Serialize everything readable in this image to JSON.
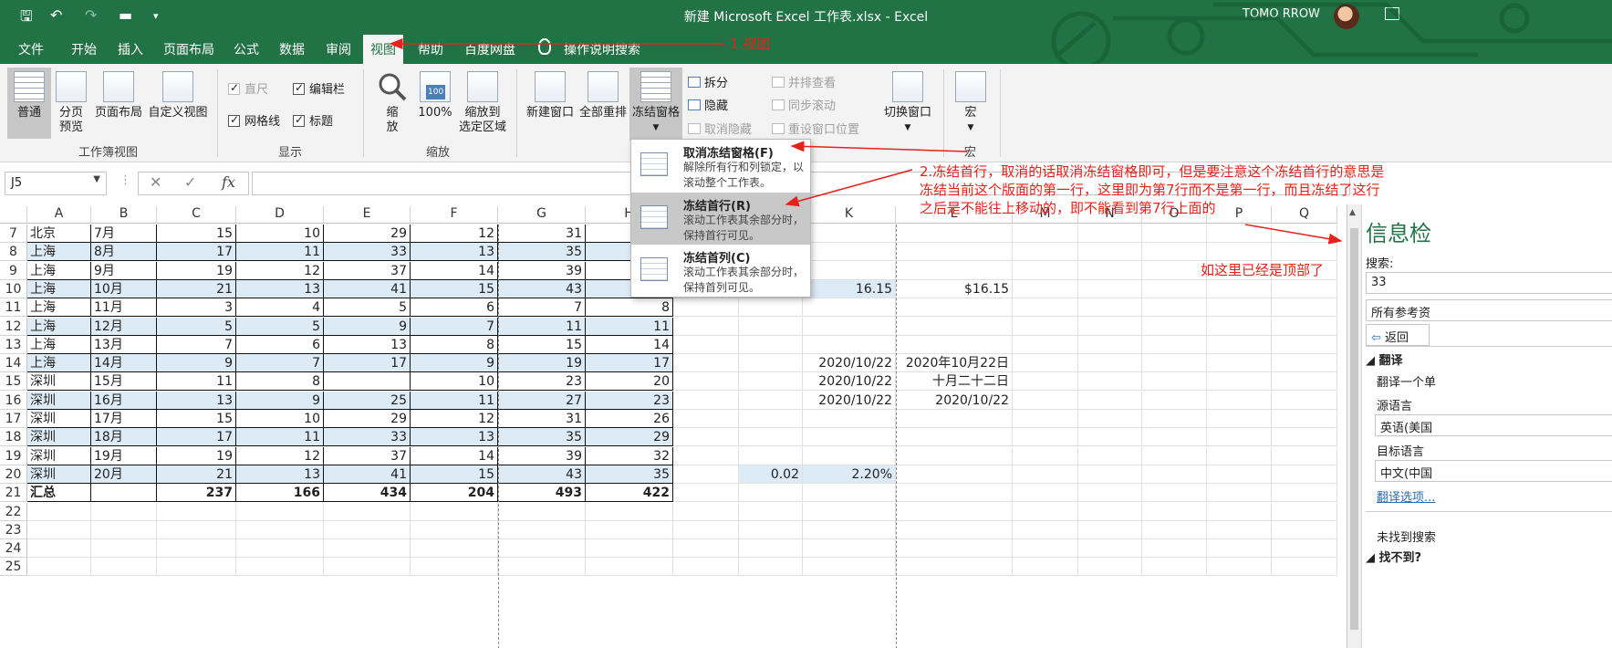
{
  "titlebar": {
    "title": "新建 Microsoft Excel 工作表.xlsx  -  Excel",
    "user": "TOMO RROW"
  },
  "tabs": [
    "文件",
    "开始",
    "插入",
    "页面布局",
    "公式",
    "数据",
    "审阅",
    "视图",
    "帮助",
    "百度网盘",
    "操作说明搜索"
  ],
  "active_tab": "视图",
  "ribbon": {
    "workbook_views": {
      "label": "工作簿视图",
      "normal": "普通",
      "page_break_line1": "分页",
      "page_break_line2": "预览",
      "page_layout": "页面布局",
      "custom": "自定义视图"
    },
    "show": {
      "label": "显示",
      "ruler": "直尺",
      "formula_bar": "编辑栏",
      "gridlines": "网格线",
      "headings": "标题"
    },
    "zoom": {
      "label": "缩放",
      "zoom_line1": "缩",
      "zoom_line2": "放",
      "zoom_100": "100%",
      "zoom_sel_line1": "缩放到",
      "zoom_sel_line2": "选定区域",
      "icon_100": "100"
    },
    "window": {
      "new_window": "新建窗口",
      "arrange_all": "全部重排",
      "freeze": "冻结窗格",
      "split": "拆分",
      "hide": "隐藏",
      "unhide": "取消隐藏",
      "side_by_side": "并排查看",
      "sync_scroll": "同步滚动",
      "reset_pos": "重设窗口位置",
      "switch_window": "切换窗口"
    },
    "macros": {
      "label": "宏",
      "macro": "宏"
    }
  },
  "formula_bar": {
    "name_box": "J5",
    "fx": "fx",
    "cancel": "✕",
    "enter": "✓"
  },
  "columns": [
    "A",
    "B",
    "C",
    "D",
    "E",
    "F",
    "G",
    "H",
    "K",
    "L",
    "M",
    "N",
    "O",
    "P",
    "Q"
  ],
  "rows": [
    {
      "n": "7",
      "a": "北京",
      "b": "7月",
      "c": "15",
      "d": "10",
      "e": "29",
      "f": "12",
      "g": "31",
      "h": ""
    },
    {
      "n": "8",
      "a": "上海",
      "b": "8月",
      "c": "17",
      "d": "11",
      "e": "33",
      "f": "13",
      "g": "35",
      "h": ""
    },
    {
      "n": "9",
      "a": "上海",
      "b": "9月",
      "c": "19",
      "d": "12",
      "e": "37",
      "f": "14",
      "g": "39",
      "h": ""
    },
    {
      "n": "10",
      "a": "上海",
      "b": "10月",
      "c": "21",
      "d": "13",
      "e": "41",
      "f": "15",
      "g": "43",
      "h": ""
    },
    {
      "n": "11",
      "a": "上海",
      "b": "11月",
      "c": "3",
      "d": "4",
      "e": "5",
      "f": "6",
      "g": "7",
      "h": "8"
    },
    {
      "n": "12",
      "a": "上海",
      "b": "12月",
      "c": "5",
      "d": "5",
      "e": "9",
      "f": "7",
      "g": "11",
      "h": "11"
    },
    {
      "n": "13",
      "a": "上海",
      "b": "13月",
      "c": "7",
      "d": "6",
      "e": "13",
      "f": "8",
      "g": "15",
      "h": "14"
    },
    {
      "n": "14",
      "a": "上海",
      "b": "14月",
      "c": "9",
      "d": "7",
      "e": "17",
      "f": "9",
      "g": "19",
      "h": "17"
    },
    {
      "n": "15",
      "a": "深圳",
      "b": "15月",
      "c": "11",
      "d": "8",
      "e": "",
      "f": "10",
      "g": "23",
      "h": "20"
    },
    {
      "n": "16",
      "a": "深圳",
      "b": "16月",
      "c": "13",
      "d": "9",
      "e": "25",
      "f": "11",
      "g": "27",
      "h": "23"
    },
    {
      "n": "17",
      "a": "深圳",
      "b": "17月",
      "c": "15",
      "d": "10",
      "e": "29",
      "f": "12",
      "g": "31",
      "h": "26"
    },
    {
      "n": "18",
      "a": "深圳",
      "b": "18月",
      "c": "17",
      "d": "11",
      "e": "33",
      "f": "13",
      "g": "35",
      "h": "29"
    },
    {
      "n": "19",
      "a": "深圳",
      "b": "19月",
      "c": "19",
      "d": "12",
      "e": "37",
      "f": "14",
      "g": "39",
      "h": "32"
    },
    {
      "n": "20",
      "a": "深圳",
      "b": "20月",
      "c": "21",
      "d": "13",
      "e": "41",
      "f": "15",
      "g": "43",
      "h": "35"
    },
    {
      "n": "21",
      "a": "汇总",
      "b": "",
      "c": "237",
      "d": "166",
      "e": "434",
      "f": "204",
      "g": "493",
      "h": "422"
    }
  ],
  "extra_rows": [
    "22",
    "23",
    "24",
    "25"
  ],
  "side_cells": {
    "r10_k": "16.15",
    "r10_l": "$16.15",
    "r14_k": "2020/10/22",
    "r14_l": "2020年10月22日",
    "r15_k": "2020/10/22",
    "r15_l": "十月二十二日",
    "r16_k": "2020/10/22",
    "r16_l": "2020/10/22",
    "r20_j": "0.02",
    "r20_k": "2.20%"
  },
  "freeze_menu": [
    {
      "title": "取消冻结窗格(F)",
      "desc": "解除所有行和列锁定，以滚动整个工作表。"
    },
    {
      "title": "冻结首行(R)",
      "desc": "滚动工作表其余部分时，保持首行可见。"
    },
    {
      "title": "冻结首列(C)",
      "desc": "滚动工作表其余部分时，保持首列可见。"
    }
  ],
  "side_pane": {
    "title": "信息检",
    "search_label": "搜索:",
    "search_value": "33",
    "scope": "所有参考资",
    "back": "返回",
    "translate": "翻译",
    "translate_desc": "翻译一个单",
    "src_label": "源语言",
    "src_value": "英语(美国",
    "tgt_label": "目标语言",
    "tgt_value": "中文(中国",
    "options_link": "翻译选项...",
    "not_found": "未找到搜索",
    "cant_find": "找不到?"
  },
  "annotations": {
    "a1": "1.视图",
    "a2": "2.冻结首行，取消的话取消冻结窗格即可，但是要注意这个冻结首行的意思是冻结当前这个版面的第一行，这里即为第7行而不是第一行，而且冻结了这行之后是不能往上移动的，即不能看到第7行上面的",
    "a3": "如这里已经是顶部了"
  },
  "colors": {
    "excel_green": "#217346",
    "annotation_red": "#e8201a",
    "row_shade": "#ddebf7"
  }
}
